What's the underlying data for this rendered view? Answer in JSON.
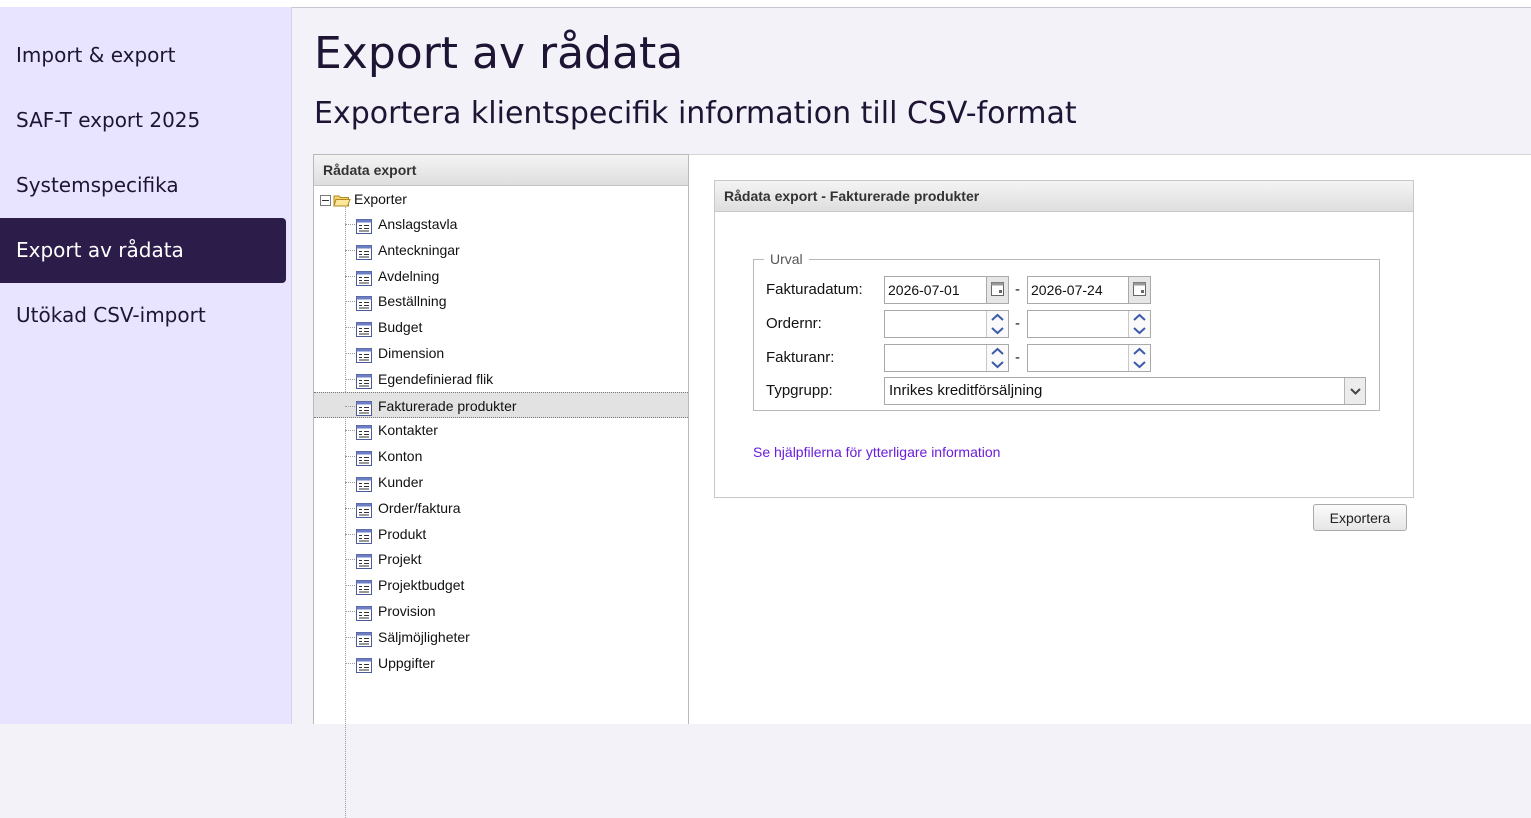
{
  "sidebar": {
    "items": [
      {
        "label": "Import & export",
        "active": false
      },
      {
        "label": "SAF-T export 2025",
        "active": false
      },
      {
        "label": "Systemspecifika",
        "active": false
      },
      {
        "label": "Export av rådata",
        "active": true
      },
      {
        "label": "Utökad CSV-import",
        "active": false
      }
    ],
    "active_bg": "#2b1c4a",
    "bg": "#e8e4ff"
  },
  "header": {
    "title": "Export av rådata",
    "subtitle": "Exportera klientspecifik information till CSV-format"
  },
  "tree": {
    "header": "Rådata export",
    "root": {
      "label": "Exporter",
      "icon": "folder-open-icon"
    },
    "selected": "Fakturerade produkter",
    "items": [
      "Anslagstavla",
      "Anteckningar",
      "Avdelning",
      "Beställning",
      "Budget",
      "Dimension",
      "Egendefinierad flik",
      "Fakturerade produkter",
      "Kontakter",
      "Konton",
      "Kunder",
      "Order/faktura",
      "Produkt",
      "Projekt",
      "Projektbudget",
      "Provision",
      "Säljmöjligheter",
      "Uppgifter"
    ]
  },
  "export": {
    "header": "Rådata export - Fakturerade produkter",
    "legend": "Urval",
    "fields": {
      "fakturadatum": {
        "label": "Fakturadatum:",
        "from": "2026-07-01",
        "to": "2026-07-24"
      },
      "ordernr": {
        "label": "Ordernr:",
        "from": "",
        "to": ""
      },
      "fakturanr": {
        "label": "Fakturanr:",
        "from": "",
        "to": ""
      },
      "typgrupp": {
        "label": "Typgrupp:",
        "value": "Inrikes kreditförsäljning"
      }
    },
    "separator": "-",
    "help_link": "Se hjälpfilerna för ytterligare information",
    "button": "Exportera",
    "link_color": "#6a1ddb"
  }
}
